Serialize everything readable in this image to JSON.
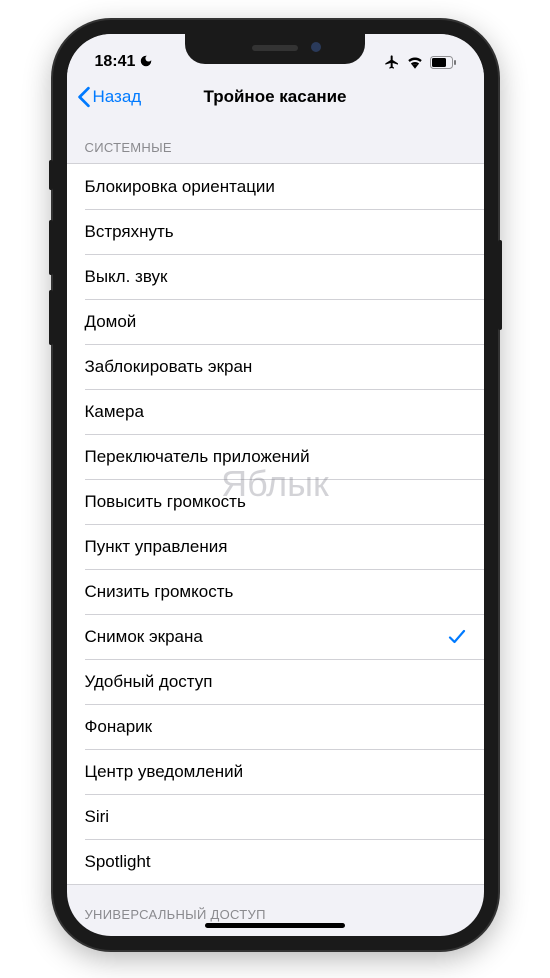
{
  "status": {
    "time": "18:41"
  },
  "nav": {
    "back_label": "Назад",
    "title": "Тройное касание"
  },
  "sections": {
    "system_header": "СИСТЕМНЫЕ",
    "accessibility_header": "УНИВЕРСАЛЬНЫЙ ДОСТУП"
  },
  "items": {
    "orientation_lock": "Блокировка ориентации",
    "shake": "Встряхнуть",
    "mute": "Выкл. звук",
    "home": "Домой",
    "lock_screen": "Заблокировать экран",
    "camera": "Камера",
    "app_switcher": "Переключатель приложений",
    "volume_up": "Повысить громкость",
    "control_center": "Пункт управления",
    "volume_down": "Снизить громкость",
    "screenshot": "Снимок экрана",
    "reachability": "Удобный доступ",
    "flashlight": "Фонарик",
    "notification_center": "Центр уведомлений",
    "siri": "Siri",
    "spotlight": "Spotlight"
  },
  "selected_item": "screenshot",
  "watermark": "Яблык",
  "colors": {
    "accent": "#007aff",
    "background": "#f2f2f7",
    "separator": "#d1d1d6",
    "secondary_text": "#8a8a8e"
  }
}
